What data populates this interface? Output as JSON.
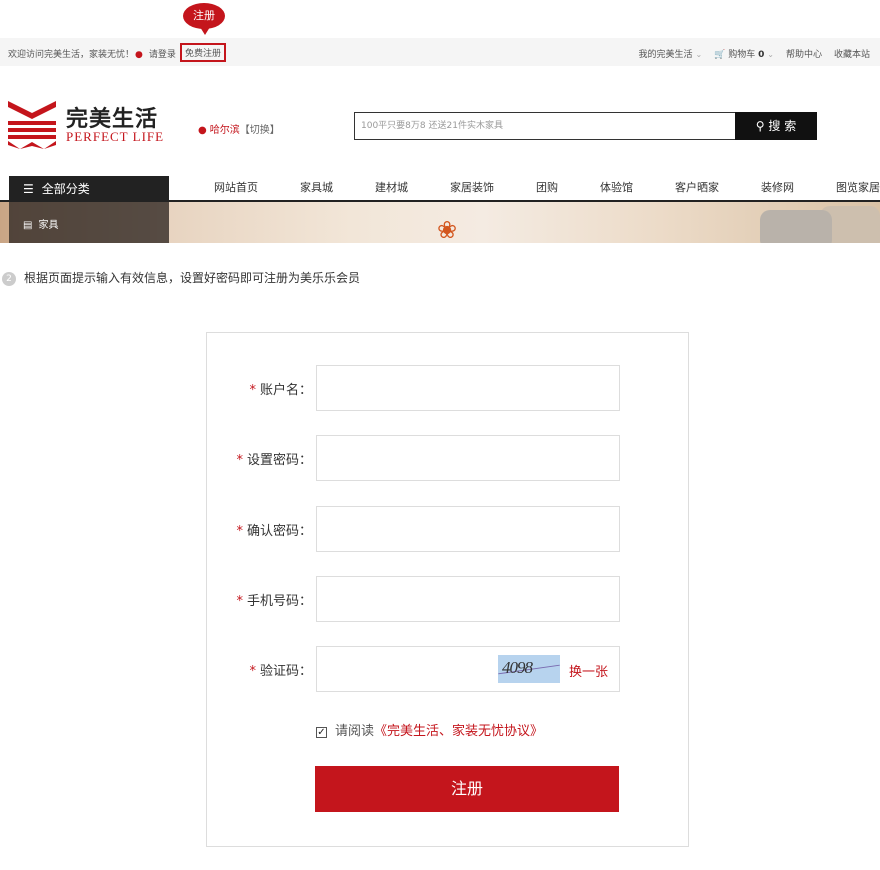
{
  "tooltip": "注册",
  "topbar": {
    "welcome": "欢迎访问完美生活，家装无忧！",
    "login": "请登录",
    "register": "免费注册",
    "my_account": "我的完美生活",
    "cart": "购物车",
    "cart_count": "0",
    "help": "帮助中心",
    "favorite": "收藏本站"
  },
  "logo": {
    "cn": "完美生活",
    "en": "PERFECT LIFE"
  },
  "city": {
    "name": "哈尔滨",
    "switch": "【切换】"
  },
  "search": {
    "placeholder": "100平只要8万8 还送21件实木家具",
    "button": "搜 索"
  },
  "nav": {
    "categories": "全部分类",
    "links": [
      "网站首页",
      "家具城",
      "建材城",
      "家居装饰",
      "团购",
      "体验馆",
      "客户晒家",
      "装修网",
      "图览家居"
    ],
    "category_item": "家具"
  },
  "step": {
    "num": "2",
    "text": "根据页面提示输入有效信息，设置好密码即可注册为美乐乐会员"
  },
  "form": {
    "star": "*",
    "username_label": "账户名：",
    "password_label": "设置密码：",
    "confirm_label": "确认密码：",
    "phone_label": "手机号码：",
    "captcha_label": "验证码：",
    "captcha_text": "4098",
    "change_captcha": "换一张",
    "agree_prefix": "请阅读",
    "agree_link": "《完美生活、家装无忧协议》",
    "submit": "注册"
  },
  "colors": {
    "accent": "#c4151c",
    "dark": "#222222"
  }
}
